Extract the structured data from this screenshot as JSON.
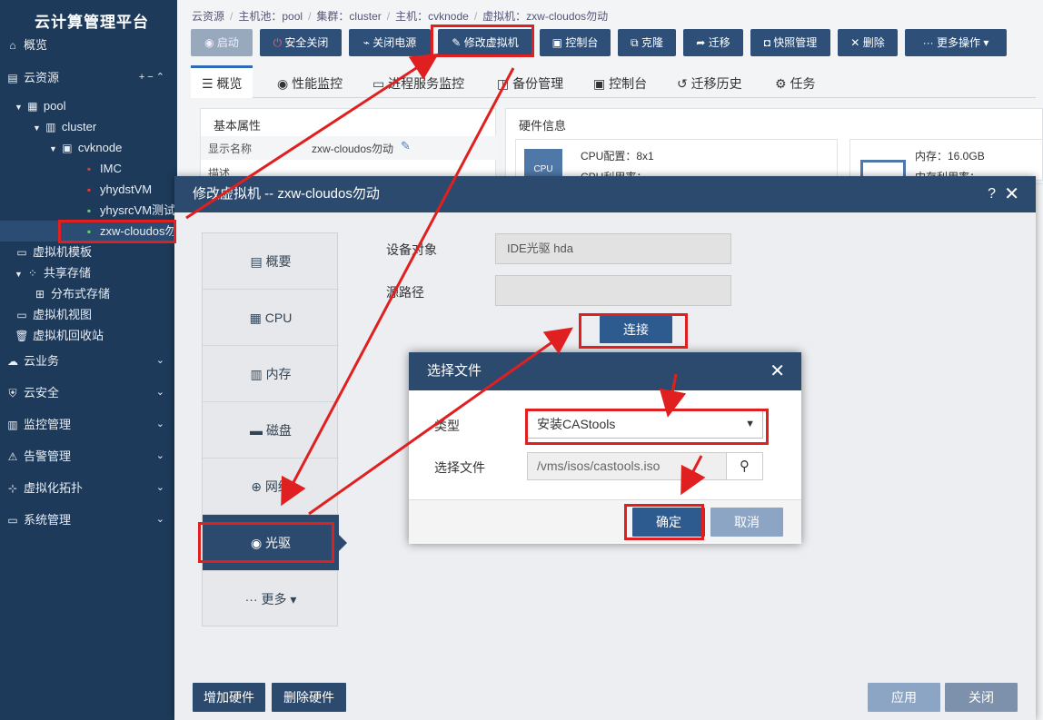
{
  "app": {
    "title": "云计算管理平台"
  },
  "sidebar": {
    "items": [
      {
        "label": "概览",
        "icon": "home-icon",
        "level": 0
      },
      {
        "label": "云资源",
        "icon": "resource-icon",
        "level": 0,
        "extra": "+  −  ⌃"
      },
      {
        "label": "pool",
        "icon": "pool-icon",
        "level": 1
      },
      {
        "label": "cluster",
        "icon": "cluster-icon",
        "level": 2
      },
      {
        "label": "cvknode",
        "icon": "host-icon",
        "level": 3
      },
      {
        "label": "IMC",
        "icon": "vm-red-icon",
        "level": 4
      },
      {
        "label": "yhydstVM",
        "icon": "vm-red-icon",
        "level": 4
      },
      {
        "label": "yhysrcVM测试",
        "icon": "vm-green-icon",
        "level": 4
      },
      {
        "label": "zxw-cloudos勿动",
        "icon": "vm-green-icon",
        "level": 4
      },
      {
        "label": "虚拟机模板",
        "icon": "template-icon",
        "level": 1
      },
      {
        "label": "共享存储",
        "icon": "storage-icon",
        "level": 1
      },
      {
        "label": "分布式存储",
        "icon": "distributed-icon",
        "level": 2
      },
      {
        "label": "虚拟机视图",
        "icon": "view-icon",
        "level": 1
      },
      {
        "label": "虚拟机回收站",
        "icon": "trash-icon",
        "level": 1
      },
      {
        "label": "云业务",
        "icon": "cloud-icon",
        "level": 0
      },
      {
        "label": "云安全",
        "icon": "shield-icon",
        "level": 0
      },
      {
        "label": "监控管理",
        "icon": "monitor-icon",
        "level": 0
      },
      {
        "label": "告警管理",
        "icon": "alarm-icon",
        "level": 0
      },
      {
        "label": "虚拟化拓扑",
        "icon": "topology-icon",
        "level": 0
      },
      {
        "label": "系统管理",
        "icon": "system-icon",
        "level": 0
      }
    ]
  },
  "breadcrumb": [
    "云资源",
    "/",
    "主机池：pool",
    "/",
    "集群：cluster",
    "/",
    "主机：cvknode",
    "/",
    "虚拟机：zxw-cloudos勿动"
  ],
  "toolbar": {
    "start": "启动",
    "safe_shutdown": "安全关闭",
    "power_off": "关闭电源",
    "modify_vm": "修改虚拟机",
    "console": "控制台",
    "clone": "克隆",
    "migrate": "迁移",
    "snapshot": "快照管理",
    "delete": "删除",
    "more": "更多操作"
  },
  "tabs": [
    "概览",
    "性能监控",
    "进程服务监控",
    "备份管理",
    "控制台",
    "迁移历史",
    "任务"
  ],
  "basic": {
    "title": "基本属性",
    "display_name_label": "显示名称",
    "display_name": "zxw-cloudos勿动",
    "desc_label": "描述"
  },
  "hardware": {
    "title": "硬件信息",
    "cpu_config": "CPU配置：8x1",
    "cpu_usage": "CPU利用率：",
    "mem": "内存：16.0GB",
    "mem_usage": "内存利用率："
  },
  "modal": {
    "title": "修改虚拟机 -- zxw-cloudos勿动",
    "help": "?",
    "nav": [
      "概要",
      "CPU",
      "内存",
      "磁盘",
      "网络",
      "光驱",
      "更多"
    ],
    "device_label": "设备对象",
    "device_value": "IDE光驱 hda",
    "source_label": "源路径",
    "source_value": "",
    "connect": "连接",
    "add_hw": "增加硬件",
    "del_hw": "删除硬件",
    "apply": "应用",
    "close": "关闭"
  },
  "dialog": {
    "title": "选择文件",
    "type_label": "类型",
    "type_value": "安装CAStools",
    "file_label": "选择文件",
    "file_value": "/vms/isos/castools.iso",
    "ok": "确定",
    "cancel": "取消"
  }
}
